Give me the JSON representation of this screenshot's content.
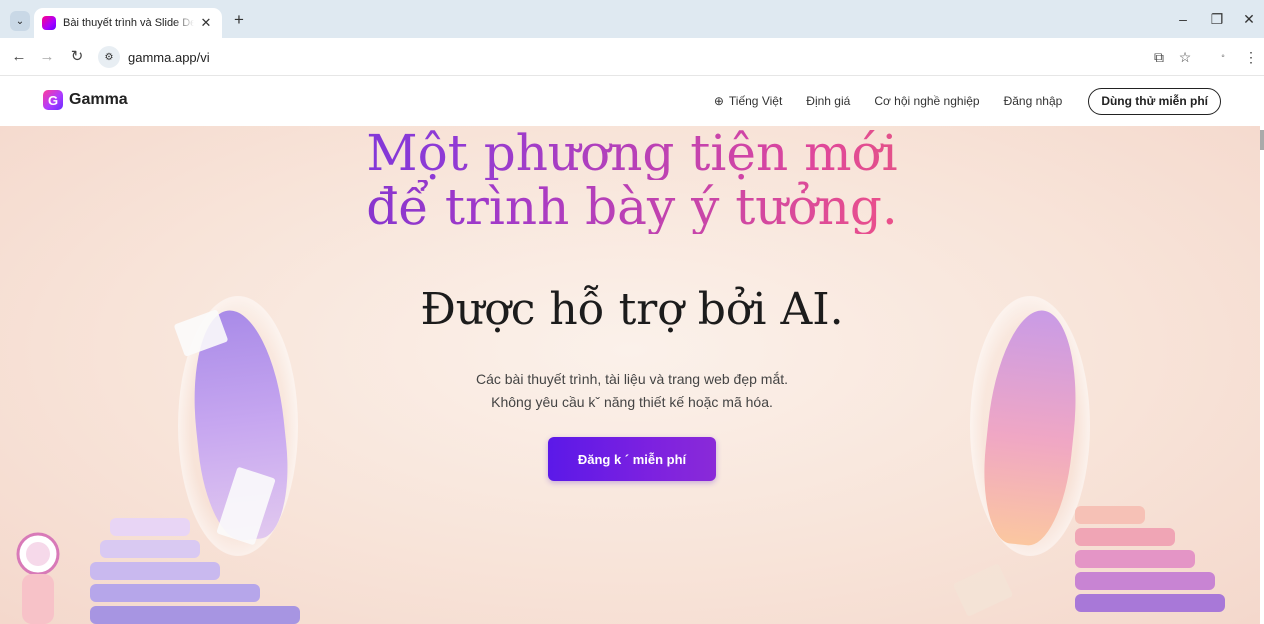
{
  "browser": {
    "tab_title": "Bài thuyết trình và Slide Decks",
    "url": "gamma.app/vi"
  },
  "header": {
    "logo_text": "Gamma",
    "nav": {
      "language": "Tiếng Việt",
      "pricing": "Định giá",
      "careers": "Cơ hội nghề nghiệp",
      "login": "Đăng nhập",
      "try_free": "Dùng thử miễn phí"
    }
  },
  "hero": {
    "headline_line1": "Một phương tiện mới",
    "headline_line2": "để trình bày ý tưởng.",
    "subheadline": "Được hỗ trợ bởi AI.",
    "description_line1": "Các bài thuyết trình, tài liệu và trang web đẹp mắt.",
    "description_line2": "Không yêu cầu kˇ năng thiết kế hoặc mã hóa.",
    "cta": "Đăng k ´ miễn phí"
  },
  "colors": {
    "cta_gradient_start": "#5b19e8",
    "cta_gradient_end": "#8a2ad8",
    "headline_purple": "#4a2de0",
    "headline_pink": "#e0479a",
    "headline_orange": "#f4863a"
  }
}
